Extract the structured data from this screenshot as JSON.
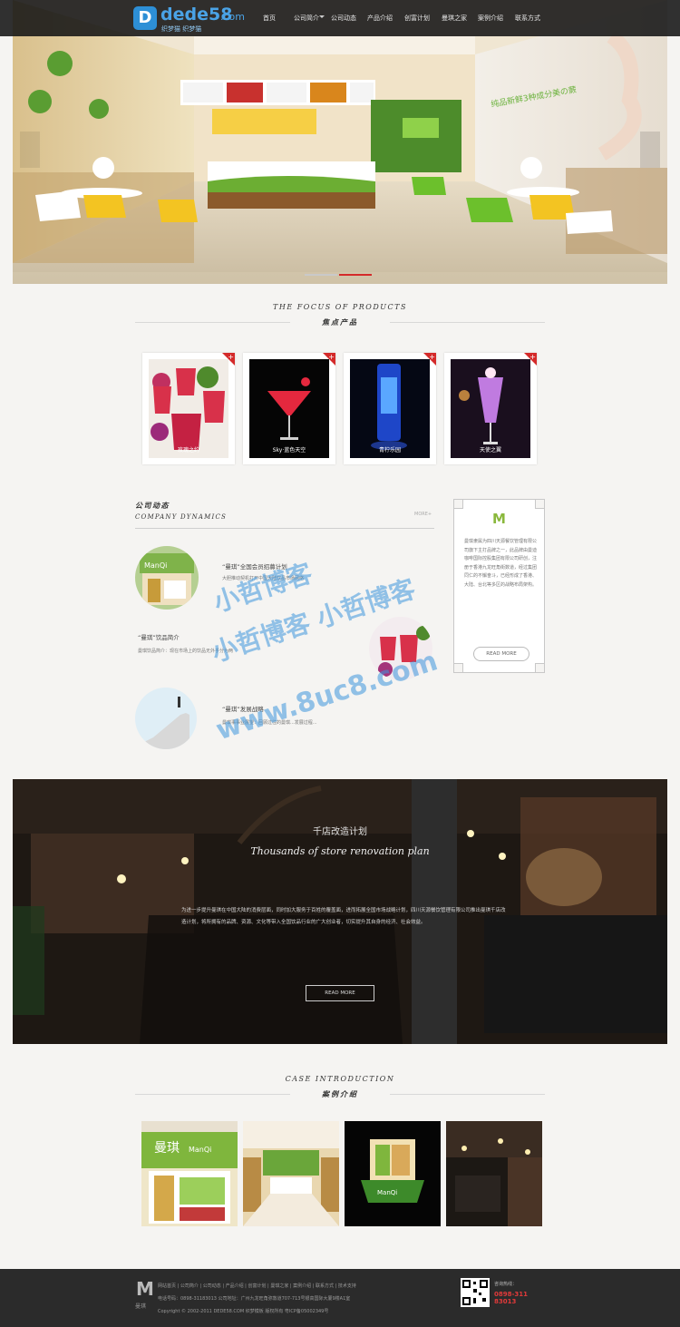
{
  "logo": {
    "mark": "D",
    "word": "dede58",
    "com": ".com",
    "sub": "织梦猫  织梦猫"
  },
  "nav": [
    "首页",
    "公司简介",
    "公司动态",
    "产品介绍",
    "创富计划",
    "曼琪之家",
    "案例介绍",
    "联系方式"
  ],
  "banner": {
    "wall_text": "纯品新鲜3种成分美の蕨"
  },
  "focus": {
    "title_en": "THE FOCUS OF PRODUCTS",
    "title_cn": "焦点产品",
    "products": [
      {
        "caption": "玫瑰之约",
        "corner": "+"
      },
      {
        "caption": "Sky·蓝色天空",
        "corner": "+"
      },
      {
        "caption": "青柠乐园",
        "corner": "+"
      },
      {
        "caption": "天使之翼",
        "corner": "+"
      }
    ]
  },
  "dynamics": {
    "title_cn": "公司动态",
    "title_en": "COMPANY DYNAMICS",
    "more": "MORE+",
    "news": [
      {
        "title": "“曼琪”全国会员招募计划",
        "desc": "大胆推动契机打开中国大陆饮品市场网络"
      },
      {
        "title": "“曼琪”饮品简介",
        "desc": "曼琪饮品简介：现在市场上的饮品无外乎分为两"
      },
      {
        "title": "“曼琪”发展战略",
        "desc": "曼琪事事业展望：回顾过往的曼琪...发展过程..."
      }
    ],
    "badge": {
      "logo": "M",
      "text": "曼琪隶属为四川天源餐饮管理有限公司旗下主打品牌之一，此品牌由曼迪咖啡国际控股集团有限公司研创，注册于香港九龙旺角街数道，经过集团同仁的不懈奋斗，已经形成了香港、大陆、台北等多区的战略布局架构。",
      "button": "READ MORE"
    }
  },
  "watermark": {
    "line1": "小哲博客",
    "line2": "小哲博客 小哲博客",
    "line3": "www.8uc8.com"
  },
  "renovation": {
    "title": "千店改造计划",
    "subtitle": "Thousands of store renovation plan",
    "desc": "为进一步提升曼琪在中国大陆的消费层面，同时加大服务于百姓的覆盖面，进而拓展全国市场战略计划，四川天源餐饮管理有限公司推出曼琪千店改造计划，将所拥有的品牌、资源、文化等带入全国饮品行业的广大创业者，切实提升其自身的经济、社会效益。",
    "button": "READ MORE"
  },
  "cases": {
    "title_en": "CASE INTRODUCTION",
    "title_cn": "案例介绍",
    "sign1": "曼琪",
    "sign2": "ManQi"
  },
  "footer": {
    "links": "网站首页 | 公司简介 | 公司动态 | 产品介绍 | 创富计划 | 曼琪之家 | 案例介绍 | 联系方式 | 技术支持",
    "contact": "电话号码：0898-31183013 公司地址：广州九龙旺角弥敦道707-713号银高国际大厦9楼A1室",
    "copyright": "Copyright © 2002-2011 DEDE58.COM 织梦模板 版权所有 粤ICP备05002349号",
    "logo": "M",
    "logo_text": "曼琪",
    "hotline_label": "咨询热线：",
    "hotline": "0898-31183013"
  },
  "colors": {
    "accent": "#d42a2a",
    "logo_blue": "#2d8fd6",
    "header": "#1e1e1e",
    "footer": "#2b2b2b"
  }
}
